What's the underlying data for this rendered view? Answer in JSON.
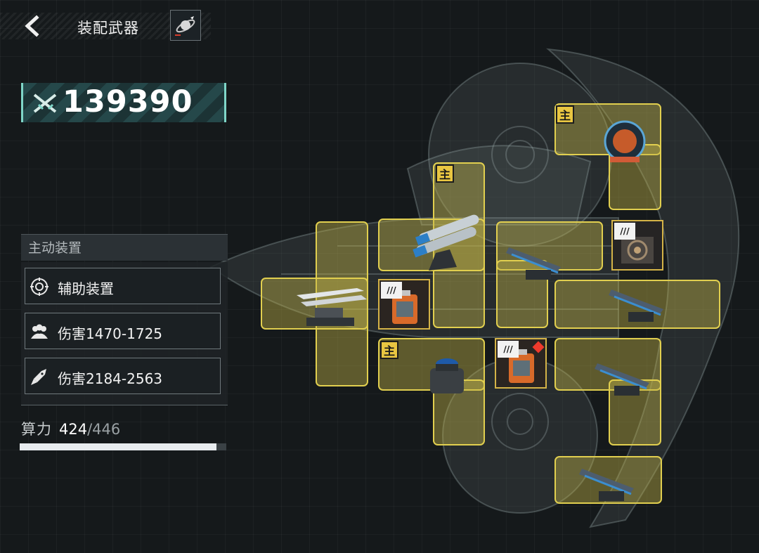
{
  "header": {
    "title": "装配武器",
    "back_icon": "chevron-left-icon",
    "planet_icon": "planet-rocket-icon"
  },
  "power": {
    "icon": "crossed-swords-icon",
    "value": "139390"
  },
  "panel": {
    "heading": "主动装置",
    "items": [
      {
        "label": "辅助装置",
        "icon": "radar-gear-icon"
      },
      {
        "label": "伤害1470-1725",
        "icon": "crew-group-icon"
      },
      {
        "label": "伤害2184-2563",
        "icon": "missile-icon"
      }
    ]
  },
  "compute": {
    "label": "算力",
    "used": "424",
    "sep": "/",
    "total": "446",
    "fraction": 0.9507
  },
  "slots": {
    "main_badge": "主",
    "chip_tag": "///"
  },
  "colors": {
    "slot_fill": "#c4b648",
    "slot_border": "#e1cf4f",
    "badge": "#e9c641",
    "power_accent": "#7fd6c8",
    "alert": "#ef3a2c"
  }
}
